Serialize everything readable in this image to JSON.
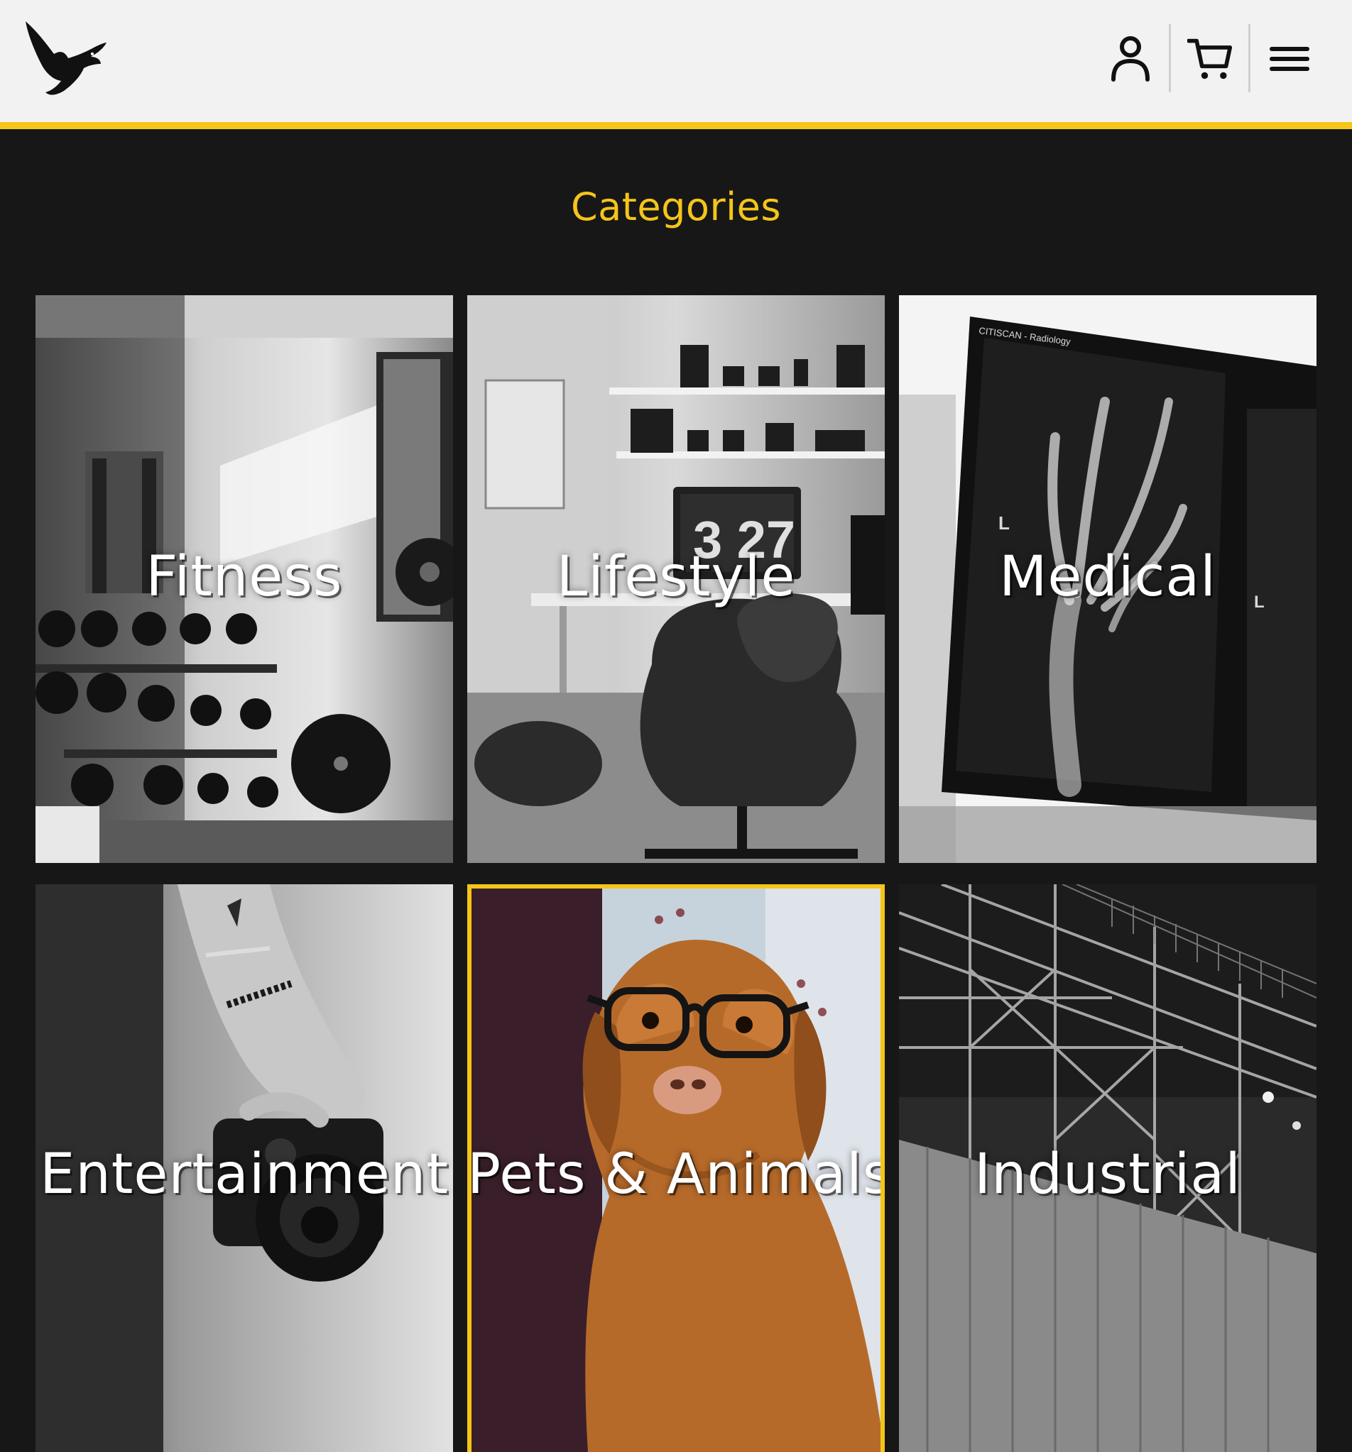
{
  "header": {
    "logo_icon": "eagle-logo-icon",
    "account_icon": "user-icon",
    "cart_icon": "cart-icon",
    "menu_icon": "hamburger-menu-icon",
    "accent_color": "#f5c518"
  },
  "main": {
    "title": "Categories",
    "categories": [
      {
        "label": "Fitness",
        "theme": "monochrome"
      },
      {
        "label": "Lifestyle",
        "theme": "monochrome"
      },
      {
        "label": "Medical",
        "theme": "monochrome"
      },
      {
        "label": "Entertainment",
        "theme": "monochrome"
      },
      {
        "label": "Pets & Animals",
        "theme": "color",
        "selected": true
      },
      {
        "label": "Industrial",
        "theme": "monochrome"
      }
    ]
  }
}
